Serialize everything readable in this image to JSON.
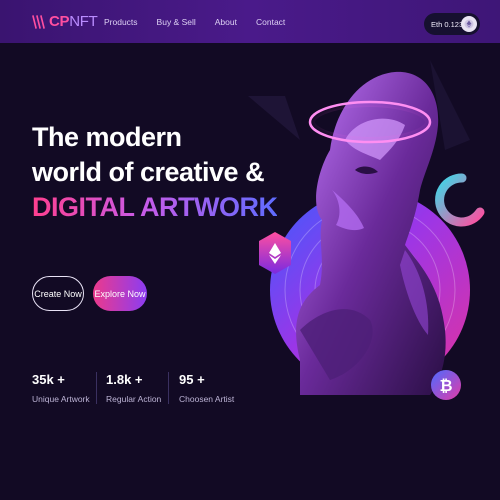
{
  "logo": {
    "cp": "CP",
    "nft": "NFT"
  },
  "nav": {
    "items": [
      "Products",
      "Buy & Sell",
      "About",
      "Contact"
    ]
  },
  "wallet": {
    "label": "Eth 0.1235"
  },
  "hero": {
    "line1": "The modern",
    "line2": "world of creative &",
    "line3": "DIGITAL ARTWORK"
  },
  "buttons": {
    "create": "Create Now",
    "explore": "Explore Now"
  },
  "stats": [
    {
      "value": "35k +",
      "label": "Unique Artwork"
    },
    {
      "value": "1.8k +",
      "label": "Regular Action"
    },
    {
      "value": "95 +",
      "label": "Choosen Artist"
    }
  ],
  "colors": {
    "navbar": "#3e1677",
    "background": "#120a24",
    "accent_pink": "#ec3a8c",
    "accent_purple": "#8b3cf2",
    "accent_blue": "#5f6cff"
  },
  "icons": [
    "logo-stripes-icon",
    "ethereum-icon",
    "bitcoin-icon",
    "neon-halo-icon",
    "cyan-ring-icon",
    "wallet-avatar-icon"
  ]
}
